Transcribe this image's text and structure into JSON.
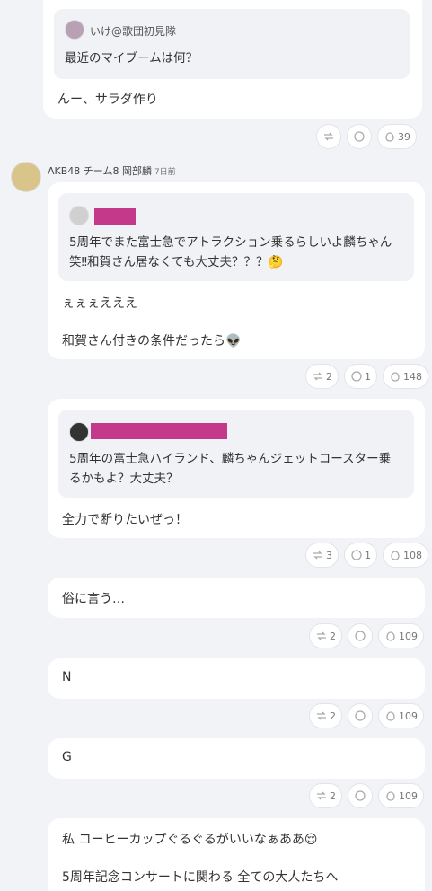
{
  "posts": [
    {
      "quote_name": "いけ@歌団初見隊",
      "quote_text": "最近のマイブームは何？",
      "body": "んー、サラダ作り",
      "counts": {
        "repost": "",
        "reply": "",
        "like": "39"
      }
    },
    {
      "author": "AKB48 チーム8 岡部麟",
      "time": "7日前",
      "quote_text_line1": "5周年でまた富士急でアトラクション乗るらしいよ麟ちゃん",
      "quote_text_line2": "笑‼和賀さん居なくても大丈夫？？？🤔",
      "body_line1": "ぇぇぇえええ",
      "body_line2": "和賀さん付きの条件だったら👽",
      "counts": {
        "repost": "2",
        "reply": "1",
        "like": "148"
      }
    },
    {
      "quote_text_line1": "5周年の富士急ハイランド、麟ちゃんジェットコースター乗",
      "quote_text_line2": "るかもよ？大丈夫？",
      "body": "全力で断りたいぜっ！",
      "counts": {
        "repost": "3",
        "reply": "1",
        "like": "108"
      }
    },
    {
      "body": "俗に言う…",
      "counts": {
        "repost": "2",
        "reply": "",
        "like": "109"
      }
    },
    {
      "body": "N",
      "counts": {
        "repost": "2",
        "reply": "",
        "like": "109"
      }
    },
    {
      "body": "G",
      "counts": {
        "repost": "2",
        "reply": "",
        "like": "109"
      }
    },
    {
      "body_line1": "私 コーヒーカップぐるぐるがいいなぁああ😌",
      "body_line2": "5周年記念コンサートに関わる 全ての大人たちへ"
    }
  ],
  "colors": {
    "background": "#f2f3f7",
    "redaction": "#c4398a"
  },
  "icons": [
    "repost-icon",
    "reply-icon",
    "like-icon"
  ]
}
